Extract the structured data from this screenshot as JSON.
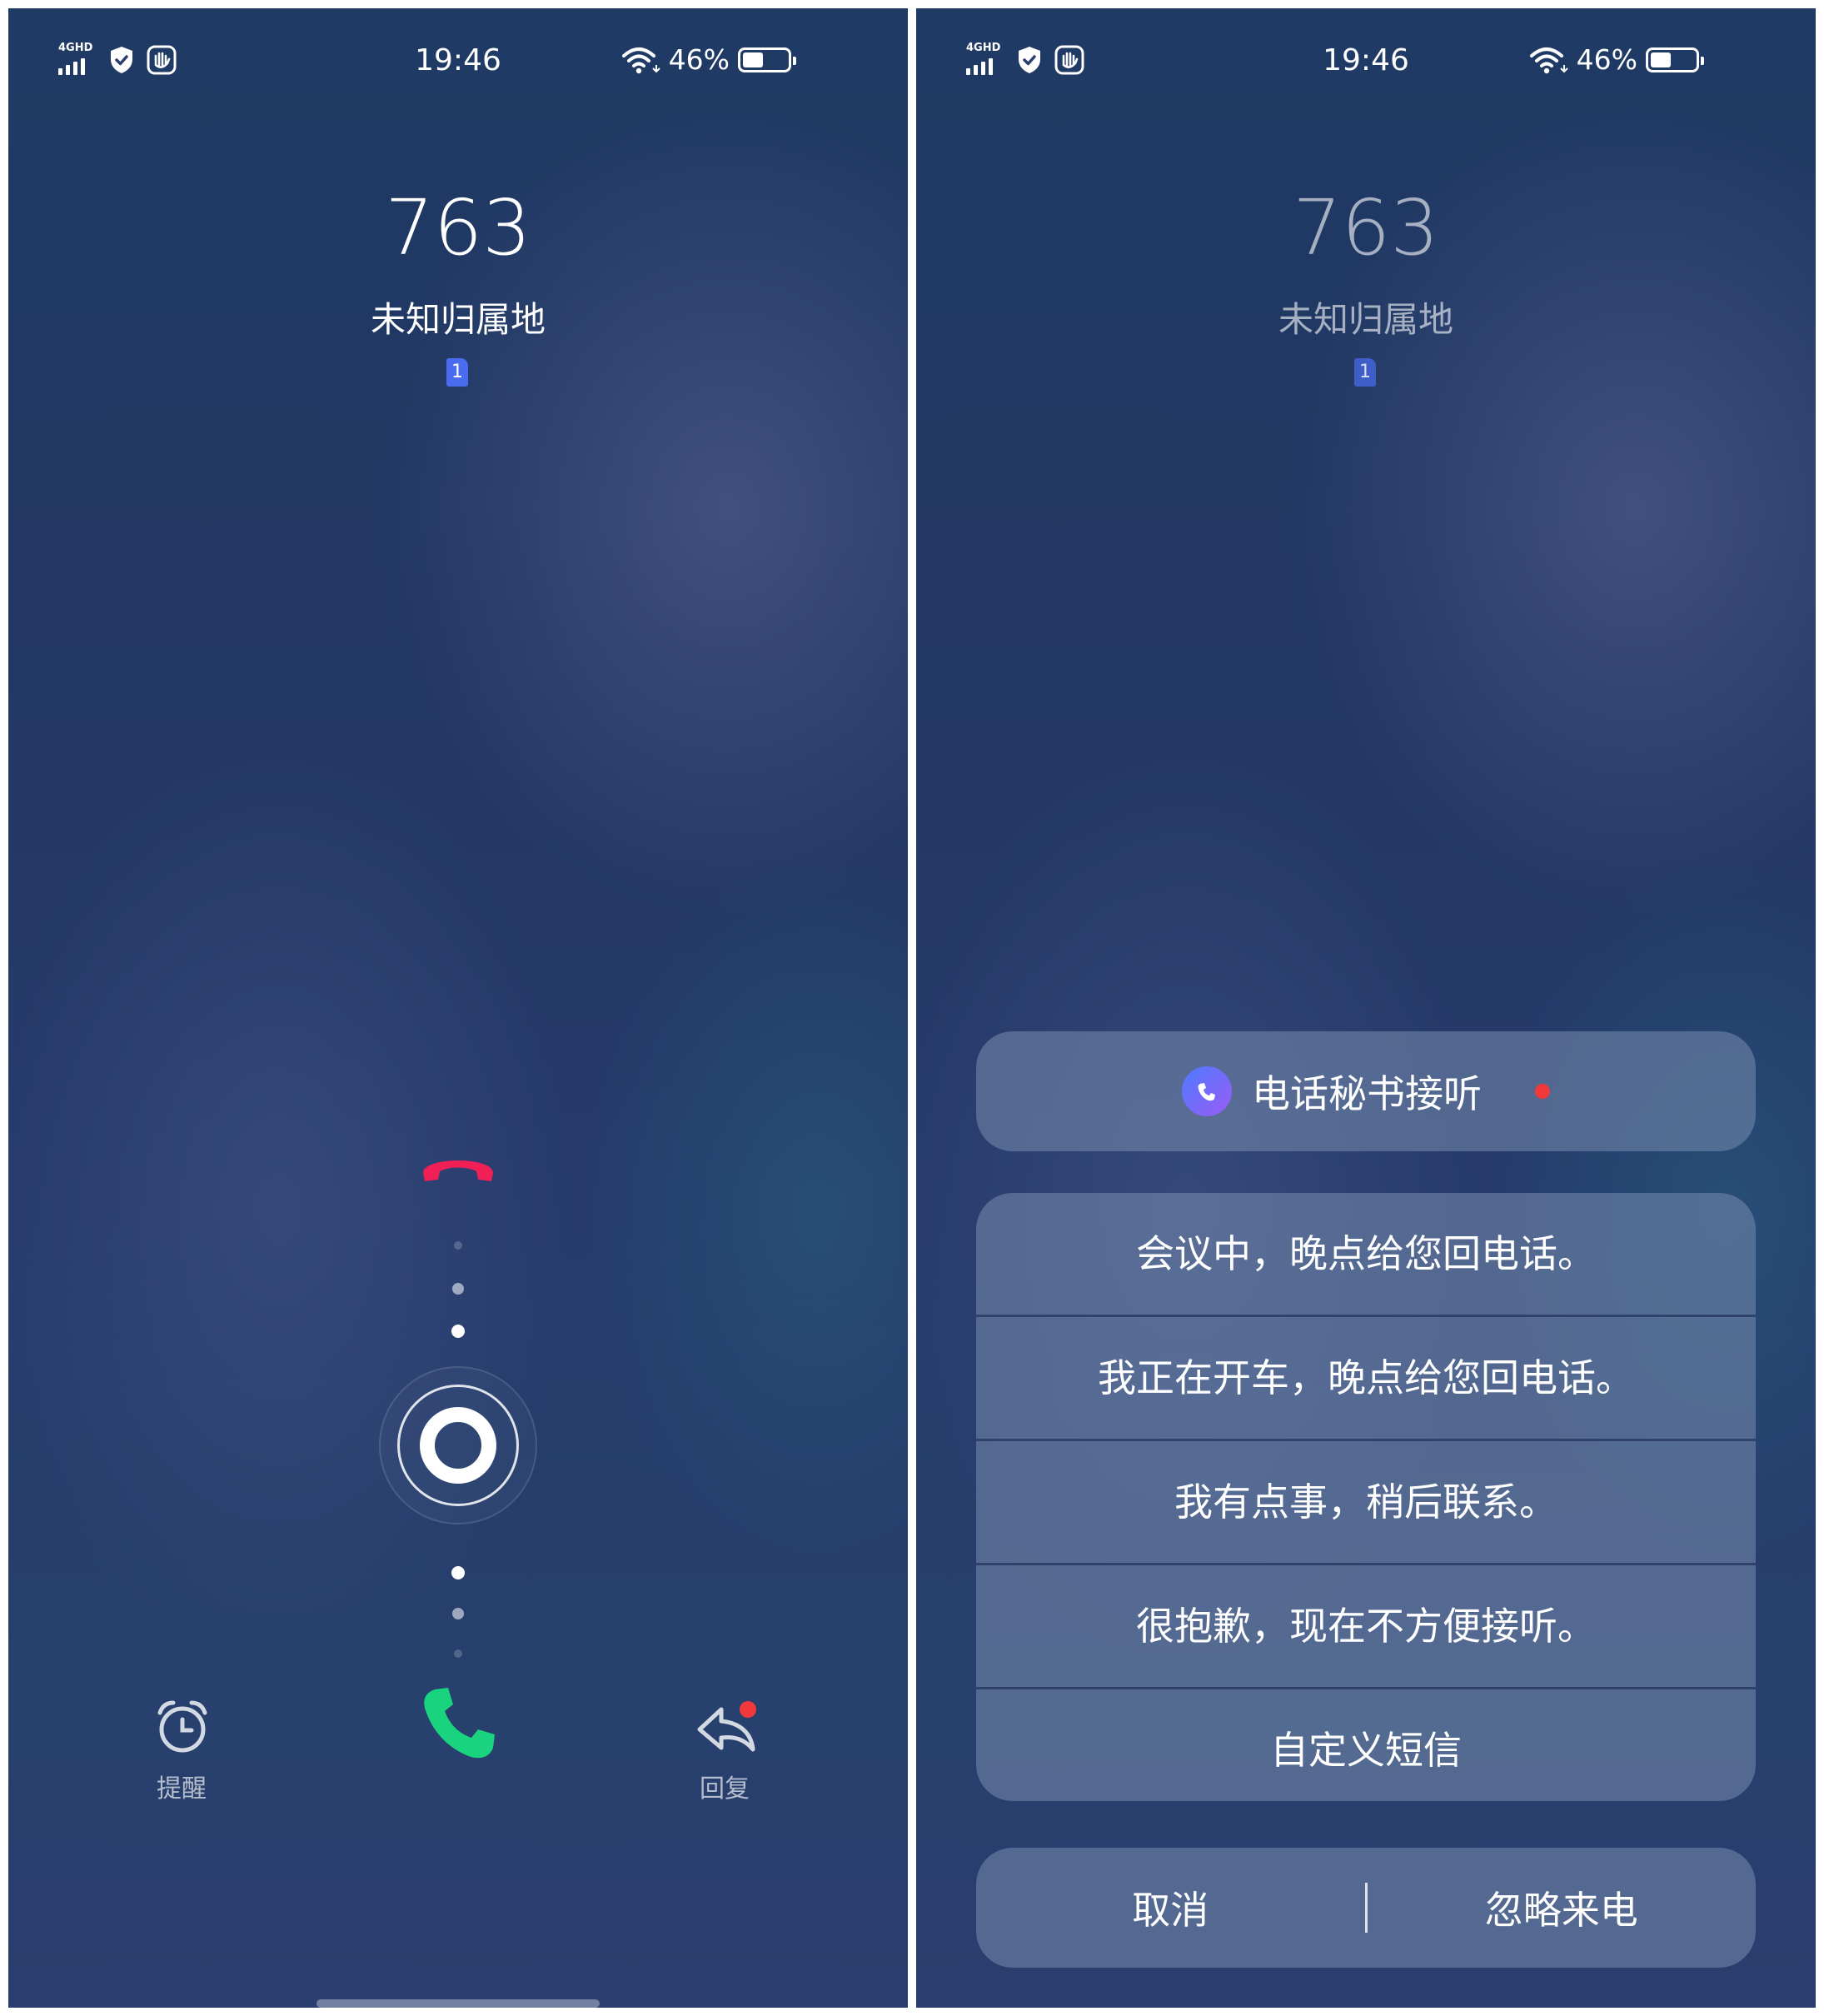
{
  "status_bar": {
    "network_label": "4GHD",
    "time": "19:46",
    "battery_percent": "46%",
    "battery_level": 0.46
  },
  "caller": {
    "number": "763",
    "location": "未知归属地",
    "sim_slot": "1"
  },
  "incoming_actions": {
    "remind_label": "提醒",
    "reply_label": "回复"
  },
  "reply_sheet": {
    "assistant_label": "电话秘书接听",
    "messages": [
      "会议中，晚点给您回电话。",
      "我正在开车，晚点给您回电话。",
      "我有点事，稍后联系。",
      "很抱歉，现在不方便接听。",
      "自定义短信"
    ],
    "cancel_label": "取消",
    "ignore_label": "忽略来电"
  },
  "colors": {
    "decline_red": "#f01f55",
    "answer_green": "#19d37e",
    "sim_blue": "#4a6cf0",
    "notification_red": "#f3383b"
  }
}
